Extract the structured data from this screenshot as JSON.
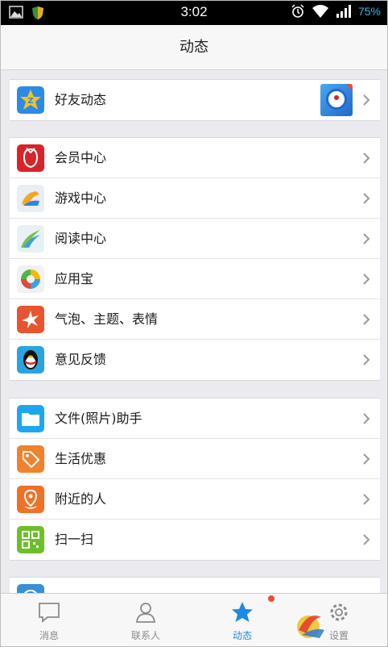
{
  "status_bar": {
    "time": "3:02",
    "battery": "75%"
  },
  "header": {
    "title": "动态"
  },
  "groups": [
    {
      "items": [
        {
          "label": "好友动态",
          "icon": "qzone-star-icon"
        }
      ]
    },
    {
      "items": [
        {
          "label": "会员中心",
          "icon": "vip-penguin-icon"
        },
        {
          "label": "游戏中心",
          "icon": "game-center-icon"
        },
        {
          "label": "阅读中心",
          "icon": "reading-center-icon"
        },
        {
          "label": "应用宝",
          "icon": "app-store-icon"
        },
        {
          "label": "气泡、主题、表情",
          "icon": "themes-icon"
        },
        {
          "label": "意见反馈",
          "icon": "qq-penguin-icon"
        }
      ]
    },
    {
      "items": [
        {
          "label": "文件(照片)助手",
          "icon": "folder-icon"
        },
        {
          "label": "生活优惠",
          "icon": "coupon-tag-icon"
        },
        {
          "label": "附近的人",
          "icon": "location-pin-icon"
        },
        {
          "label": "扫一扫",
          "icon": "qr-code-icon"
        }
      ]
    }
  ],
  "tabs": [
    {
      "label": "消息",
      "icon": "chat-bubble-icon"
    },
    {
      "label": "联系人",
      "icon": "contact-person-icon"
    },
    {
      "label": "动态",
      "icon": "star-icon"
    },
    {
      "label": "设置",
      "icon": "gear-icon"
    }
  ],
  "colors": {
    "accent": "#1e88e5",
    "badge": "#f04b3a"
  }
}
